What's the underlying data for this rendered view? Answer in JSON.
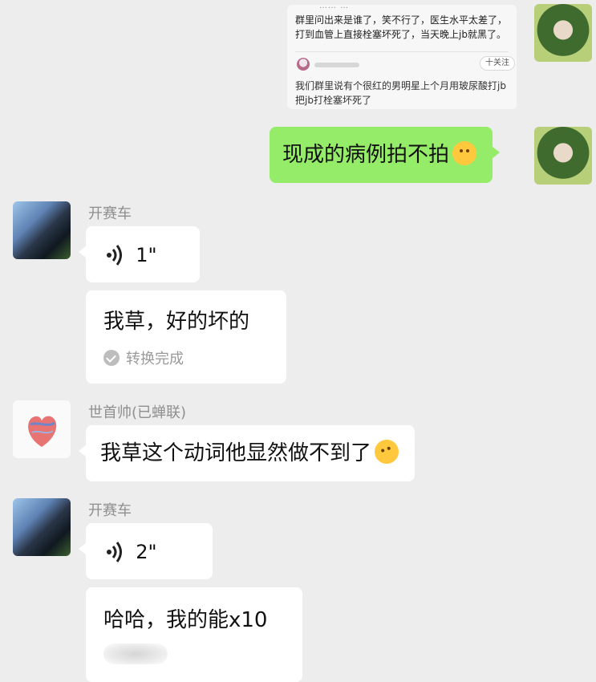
{
  "quote_card": {
    "clipped_header": "…… …",
    "text": "群里问出来是谁了，笑不行了，医生水平太差了，打到血管上直接栓塞坏死了，当天晚上jb就黑了。",
    "follow_label": "十关注",
    "reply": "我们群里说有个很红的男明星上个月用玻尿酸打jb把jb打栓塞坏死了"
  },
  "messages": [
    {
      "side": "right",
      "text": "现成的病例拍不拍",
      "emoji": "shushing-face"
    },
    {
      "side": "left",
      "sender": "开赛车",
      "voice_duration": "1\""
    },
    {
      "side": "left",
      "text": "我草，好的坏的",
      "status": "转换完成"
    },
    {
      "side": "left",
      "sender": "世首帅(已蝉联)",
      "text": "我草这个动词他显然做不到了",
      "emoji": "rolling-laughing-face"
    },
    {
      "side": "left",
      "sender": "开赛车",
      "voice_duration": "2\""
    },
    {
      "side": "left",
      "text": "哈哈，我的能x10"
    }
  ],
  "colors": {
    "background": "#ededed",
    "own_bubble": "#95ec69",
    "other_bubble": "#ffffff",
    "sender_name": "#8f8f8f"
  }
}
